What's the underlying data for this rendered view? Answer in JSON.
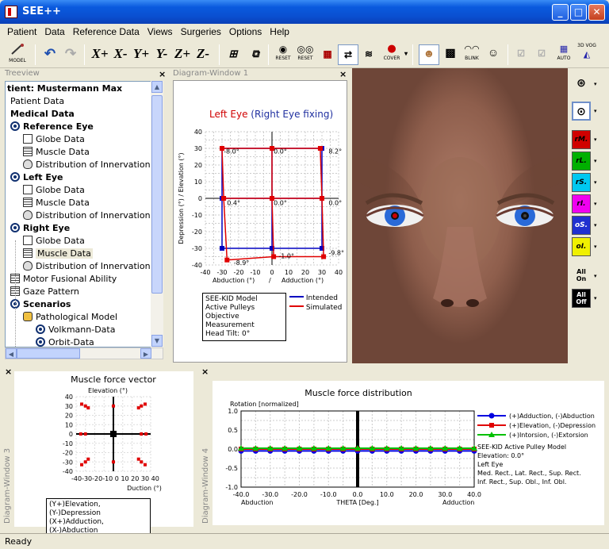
{
  "window": {
    "title": "SEE++"
  },
  "menu": [
    "Patient",
    "Data",
    "Reference Data",
    "Views",
    "Surgeries",
    "Options",
    "Help"
  ],
  "toolbar": {
    "model_label": "MODEL",
    "axes": [
      "X+",
      "X-",
      "Y+",
      "Y-",
      "Z+",
      "Z-"
    ],
    "reset1": "RESET",
    "reset2": "RESET",
    "cover": "COVER",
    "blink": "BLINK",
    "auto": "AUTO",
    "vog": "3D VOG"
  },
  "treeview": {
    "header": "Treeview",
    "items": [
      {
        "label": "tient: Mustermann Max",
        "bold": true,
        "icon": "none",
        "indent": 0
      },
      {
        "label": "Patient Data",
        "bold": false,
        "icon": "none",
        "indent": 4
      },
      {
        "label": "Medical Data",
        "bold": true,
        "icon": "none",
        "indent": 4
      },
      {
        "label": "Reference Eye",
        "bold": true,
        "icon": "eye-icon",
        "indent": 4
      },
      {
        "label": "Globe Data",
        "bold": false,
        "icon": "globe-icon",
        "indent": 20
      },
      {
        "label": "Muscle Data",
        "bold": false,
        "icon": "muscle-icon",
        "indent": 20
      },
      {
        "label": "Distribution of Innervations",
        "bold": false,
        "icon": "brain-icon",
        "indent": 20
      },
      {
        "label": "Left Eye",
        "bold": true,
        "icon": "eye-icon",
        "indent": 4
      },
      {
        "label": "Globe Data",
        "bold": false,
        "icon": "globe-icon",
        "indent": 20
      },
      {
        "label": "Muscle Data",
        "bold": false,
        "icon": "muscle-icon",
        "indent": 20
      },
      {
        "label": "Distribution of Innervations",
        "bold": false,
        "icon": "brain-icon",
        "indent": 20
      },
      {
        "label": "Right Eye",
        "bold": true,
        "icon": "eye-icon",
        "indent": 4
      },
      {
        "label": "Globe Data",
        "bold": false,
        "icon": "globe-icon",
        "indent": 20
      },
      {
        "label": "Muscle Data",
        "bold": false,
        "icon": "muscle-icon",
        "indent": 20,
        "selected": true
      },
      {
        "label": "Distribution of Innervations",
        "bold": false,
        "icon": "brain-icon",
        "indent": 20
      },
      {
        "label": "Motor Fusional Ability",
        "bold": false,
        "icon": "grid-icon",
        "indent": 4
      },
      {
        "label": "Gaze Pattern",
        "bold": false,
        "icon": "grid-icon",
        "indent": 4
      },
      {
        "label": "Scenarios",
        "bold": true,
        "icon": "eye-icon",
        "indent": 4
      },
      {
        "label": "Pathological Model",
        "bold": false,
        "icon": "lock-icon",
        "indent": 20
      },
      {
        "label": "Volkmann-Data",
        "bold": false,
        "icon": "eye-icon",
        "indent": 36
      },
      {
        "label": "Orbit-Data",
        "bold": false,
        "icon": "eye-icon",
        "indent": 36
      }
    ]
  },
  "diagram1": {
    "header": "Diagram-Window 1",
    "title_a": "Left Eye",
    "title_b": "(Right Eye fixing)",
    "ylabel": "Depression (°)  / Elevation (°)",
    "xlabel_a": "Abduction (°)",
    "xlabel_sep": "/",
    "xlabel_b": "Adduction (°)",
    "point_labels": [
      "-8.0°",
      "0.0°",
      "8.2°",
      "0.4°",
      "0.0°",
      "0.0°",
      "-8.9°",
      "-1.0°",
      "-9.8°"
    ],
    "xticks": [
      "-40",
      "-30",
      "-20",
      "-10",
      "0",
      "10",
      "20",
      "30",
      "40"
    ],
    "yticks": [
      "40",
      "30",
      "20",
      "10",
      "0",
      "-10",
      "-20",
      "-30",
      "-40"
    ],
    "info": [
      "SEE-KID Model",
      "Active Pulleys",
      "Objective Measurement",
      "Head Tilt: 0°"
    ],
    "legend": [
      "Intended",
      "Simulated"
    ]
  },
  "rightpanel": {
    "muscles": [
      "rM.",
      "rL.",
      "rS.",
      "rI.",
      "oS.",
      "oI."
    ],
    "muscle_colors": [
      "#d00000",
      "#00b000",
      "#00c8f0",
      "#f000f0",
      "#2030d0",
      "#f0f000"
    ],
    "all_on": "All On",
    "all_off": "All Off"
  },
  "diagram3": {
    "header": "Diagram-Window 3",
    "title": "Muscle force vector",
    "ylabel": "Elevation (°)",
    "xlabel": "Duction (°)",
    "xticks": "-40-30-20-10 0 10 20 30 40",
    "yticks": [
      "40",
      "30",
      "20",
      "10",
      "0",
      "-10",
      "-20",
      "-30",
      "-40"
    ],
    "legend": [
      "(Y+)Elevation, (Y-)Depression",
      "(X+)Adduction, (X-)Abduction"
    ]
  },
  "diagram4": {
    "header": "Diagram-Window 4",
    "title": "Muscle force distribution",
    "ylabel": "Rotation [normalized]",
    "xlabel": "THETA [Deg.]",
    "xlabel_left": "Abduction",
    "xlabel_right": "Adduction",
    "xticks": [
      "-40.0",
      "-30.0",
      "-20.0",
      "-10.0",
      "0.0",
      "10.0",
      "20.0",
      "30.0",
      "40.0"
    ],
    "yticks": [
      "1.0",
      "0.5",
      "0.0",
      "-0.5",
      "-1.0"
    ],
    "legend": [
      "(+)Adduction, (-)Abduction",
      "(+)Elevation, (-)Depression",
      "(+)Intorsion, (-)Extorsion"
    ],
    "info": [
      "SEE-KID Active Pulley Model",
      "Elevation: 0.0°",
      "Left Eye",
      "Med. Rect., Lat. Rect., Sup. Rect.",
      "Inf. Rect., Sup. Obl., Inf. Obl."
    ]
  },
  "status": "Ready",
  "chart_data": [
    {
      "type": "line",
      "title": "Left Eye (Right Eye fixing)",
      "xlabel": "Abduction (°) / Adduction (°)",
      "ylabel": "Depression (°)  / Elevation (°)",
      "xlim": [
        -40,
        40
      ],
      "ylim": [
        -40,
        40
      ],
      "series": [
        {
          "name": "Intended",
          "color": "#0000c0",
          "points": [
            [
              -30,
              30
            ],
            [
              0,
              30
            ],
            [
              30,
              30
            ],
            [
              -30,
              0
            ],
            [
              0,
              0
            ],
            [
              30,
              0
            ],
            [
              -30,
              -30
            ],
            [
              0,
              -30
            ],
            [
              30,
              -30
            ]
          ]
        },
        {
          "name": "Simulated",
          "color": "#e00000",
          "points": [
            [
              -30,
              30
            ],
            [
              0,
              30
            ],
            [
              29,
              30
            ],
            [
              -29,
              0
            ],
            [
              0,
              0
            ],
            [
              30,
              0
            ],
            [
              -27,
              -37
            ],
            [
              1,
              -35
            ],
            [
              31,
              -35
            ]
          ]
        }
      ]
    },
    {
      "type": "scatter",
      "title": "Muscle force vector",
      "xlabel": "Duction (°)",
      "ylabel": "Elevation (°)",
      "xlim": [
        -40,
        40
      ],
      "ylim": [
        -40,
        40
      ]
    },
    {
      "type": "line",
      "title": "Muscle force distribution",
      "xlabel": "THETA [Deg.]",
      "ylabel": "Rotation [normalized]",
      "xlim": [
        -40,
        40
      ],
      "ylim": [
        -1,
        1
      ],
      "series": [
        {
          "name": "(+)Adduction, (-)Abduction",
          "color": "#0000e0",
          "values": [
            -0.05,
            -0.05,
            -0.05,
            -0.05,
            -0.05,
            -0.05,
            -0.05,
            -0.05,
            -0.05,
            -0.05,
            -0.05,
            -0.05,
            -0.05,
            -0.05,
            -0.05,
            -0.05,
            -0.05
          ]
        },
        {
          "name": "(+)Elevation, (-)Depression",
          "color": "#e00000",
          "values": [
            0.0,
            0.0,
            0.0,
            0.0,
            0.0,
            0.0,
            0.0,
            0.0,
            0.0,
            0.0,
            0.0,
            0.0,
            0.0,
            0.0,
            0.0,
            0.0,
            0.0
          ]
        },
        {
          "name": "(+)Intorsion, (-)Extorsion",
          "color": "#00c000",
          "values": [
            0.02,
            0.02,
            0.02,
            0.02,
            0.02,
            0.02,
            0.02,
            0.02,
            0.02,
            0.02,
            0.02,
            0.02,
            0.02,
            0.02,
            0.02,
            0.02,
            0.02
          ]
        }
      ]
    }
  ]
}
